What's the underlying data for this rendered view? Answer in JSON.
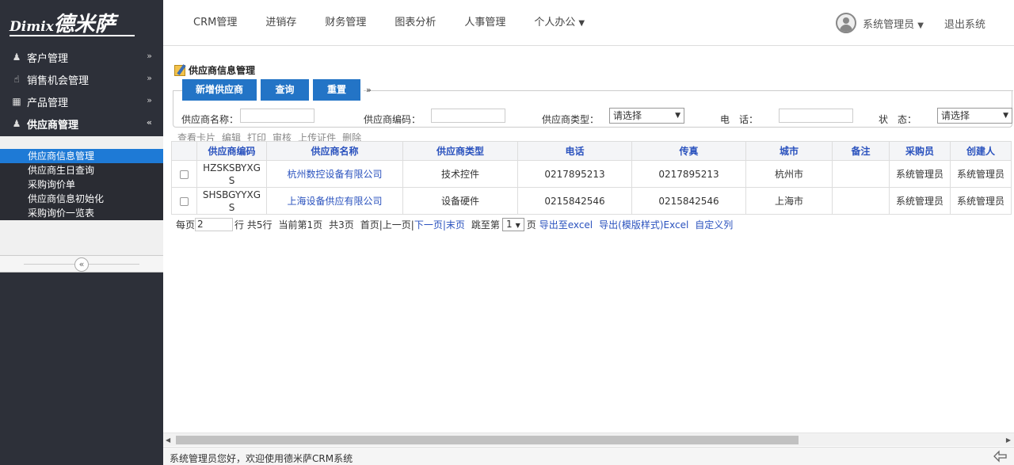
{
  "header": {
    "logo_brand": "Dimix",
    "logo_cn": "德米萨",
    "nav": [
      "CRM管理",
      "进销存",
      "财务管理",
      "图表分析",
      "人事管理",
      "个人办公"
    ],
    "user_name": "系统管理员",
    "logout": "退出系统"
  },
  "sidebar": {
    "menus": [
      {
        "label": "客户管理",
        "icon": "user-icon"
      },
      {
        "label": "销售机会管理",
        "icon": "thumbs-up-icon"
      },
      {
        "label": "产品管理",
        "icon": "grid-icon"
      },
      {
        "label": "供应商管理",
        "icon": "user-icon"
      }
    ],
    "sub_items": [
      "供应商信息管理",
      "供应商生日查询",
      "采购询价单",
      "供应商信息初始化",
      "采购询价一览表"
    ]
  },
  "main": {
    "title": "供应商信息管理",
    "buttons": {
      "add": "新增供应商",
      "query": "查询",
      "reset": "重置"
    },
    "search": {
      "name_label": "供应商名称：",
      "code_label": "供应商编码：",
      "type_label": "供应商类型：",
      "type_value": "请选择",
      "phone_label": "电　话：",
      "status_label": "状　态：",
      "status_value": "请选择"
    },
    "actions": [
      "查看卡片",
      "编辑",
      "打印",
      "审核",
      "上传证件",
      "删除"
    ],
    "table": {
      "headers": [
        "供应商编码",
        "供应商名称",
        "供应商类型",
        "电话",
        "传真",
        "城市",
        "备注",
        "采购员",
        "创建人"
      ],
      "rows": [
        {
          "code": "HZSKSBYXGS",
          "name": "杭州数控设备有限公司",
          "type": "技术控件",
          "phone": "0217895213",
          "fax": "0217895213",
          "city": "杭州市",
          "note": "",
          "buyer": "系统管理员",
          "creator": "系统管理员"
        },
        {
          "code": "SHSBGYYXGS",
          "name": "上海设备供应有限公司",
          "type": "设备硬件",
          "phone": "0215842546",
          "fax": "0215842546",
          "city": "上海市",
          "note": "",
          "buyer": "系统管理员",
          "creator": "系统管理员"
        }
      ]
    },
    "pager": {
      "per_page_label": "每页",
      "per_page_value": "2",
      "rows_text": "行 共5行",
      "current_text": "当前第1页",
      "total_text": "共3页",
      "first_prev": "首页|上一页|",
      "next": "下一页",
      "sep": "|",
      "last": "末页",
      "jump_label": "跳至第",
      "jump_value": "1",
      "page_unit": "页",
      "export_excel": "导出至excel",
      "export_template": "导出(模版样式)Excel",
      "custom_columns": "自定义列"
    }
  },
  "statusbar": {
    "text": "系统管理员您好，欢迎使用德米萨CRM系统"
  },
  "colors": {
    "sidebar_bg": "#2d3039",
    "accent": "#2374c6",
    "link": "#2a52be",
    "active_sub": "#1e7ad6"
  }
}
